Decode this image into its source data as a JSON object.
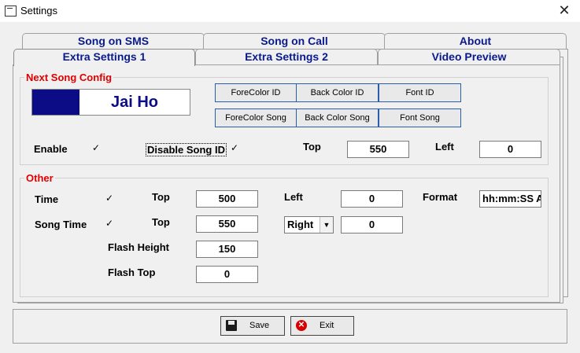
{
  "window": {
    "title": "Settings",
    "close_glyph": "✕"
  },
  "tabs_back": [
    "Song on SMS",
    "Song on Call",
    "About"
  ],
  "tabs_front": [
    "Extra Settings 1",
    "Extra Settings 2",
    "Video Preview"
  ],
  "next_song": {
    "group_title": "Next Song Config",
    "preview_text": "Jai Ho",
    "preview_bg": "#0c0c86",
    "buttons": [
      "ForeColor ID",
      "Back Color ID",
      "Font ID",
      "ForeColor Song",
      "Back Color Song",
      "Font Song"
    ],
    "enable_label": "Enable",
    "disable_song_id_label": "Disable Song ID",
    "top_label": "Top",
    "top_value": "550",
    "left_label": "Left",
    "left_value": "0",
    "check": "✓"
  },
  "other": {
    "group_title": "Other",
    "time_label": "Time",
    "time_top_label": "Top",
    "time_top_value": "500",
    "time_left_label": "Left",
    "time_left_value": "0",
    "format_label": "Format",
    "format_value": "hh:mm:SS A",
    "song_time_label": "Song Time",
    "song_time_top_label": "Top",
    "song_time_top_value": "550",
    "align_value": "Right",
    "align_offset_value": "0",
    "flash_height_label": "Flash Height",
    "flash_height_value": "150",
    "flash_top_label": "Flash Top",
    "flash_top_value": "0",
    "check": "✓"
  },
  "actions": {
    "save_label": "Save",
    "exit_label": "Exit",
    "exit_glyph": "✕"
  }
}
